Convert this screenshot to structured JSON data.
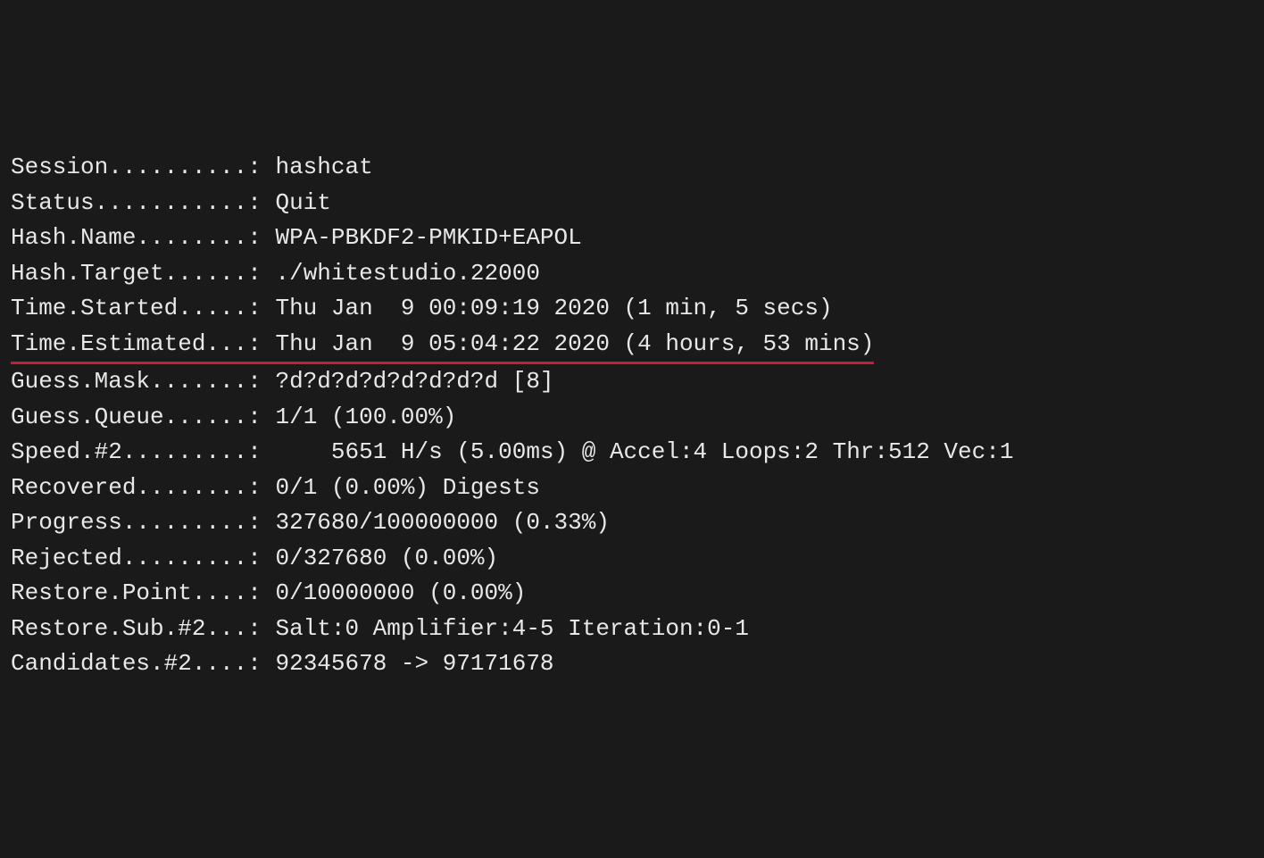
{
  "rows": [
    {
      "label": "Session",
      "dots": "..........",
      "value": "hashcat",
      "underline": false
    },
    {
      "label": "Status",
      "dots": "...........",
      "value": "Quit",
      "underline": false
    },
    {
      "label": "Hash.Name",
      "dots": "........",
      "value": "WPA-PBKDF2-PMKID+EAPOL",
      "underline": false
    },
    {
      "label": "Hash.Target",
      "dots": "......",
      "value": "./whitestudio.22000",
      "underline": false
    },
    {
      "label": "Time.Started",
      "dots": ".....",
      "value": "Thu Jan  9 00:09:19 2020 (1 min, 5 secs)",
      "underline": false
    },
    {
      "label": "Time.Estimated",
      "dots": "...",
      "value": "Thu Jan  9 05:04:22 2020 (4 hours, 53 mins)",
      "underline": true
    },
    {
      "label": "Guess.Mask",
      "dots": ".......",
      "value": "?d?d?d?d?d?d?d?d [8]",
      "underline": false
    },
    {
      "label": "Guess.Queue",
      "dots": "......",
      "value": "1/1 (100.00%)",
      "underline": false
    },
    {
      "label": "Speed.#2",
      "dots": ".........",
      "value": "    5651 H/s (5.00ms) @ Accel:4 Loops:2 Thr:512 Vec:1",
      "underline": false
    },
    {
      "label": "Recovered",
      "dots": "........",
      "value": "0/1 (0.00%) Digests",
      "underline": false
    },
    {
      "label": "Progress",
      "dots": ".........",
      "value": "327680/100000000 (0.33%)",
      "underline": false
    },
    {
      "label": "Rejected",
      "dots": ".........",
      "value": "0/327680 (0.00%)",
      "underline": false
    },
    {
      "label": "Restore.Point",
      "dots": "....",
      "value": "0/10000000 (0.00%)",
      "underline": false
    },
    {
      "label": "Restore.Sub.#2",
      "dots": "...",
      "value": "Salt:0 Amplifier:4-5 Iteration:0-1",
      "underline": false
    },
    {
      "label": "Candidates.#2",
      "dots": "....",
      "value": "92345678 -> 97171678",
      "underline": false
    }
  ]
}
